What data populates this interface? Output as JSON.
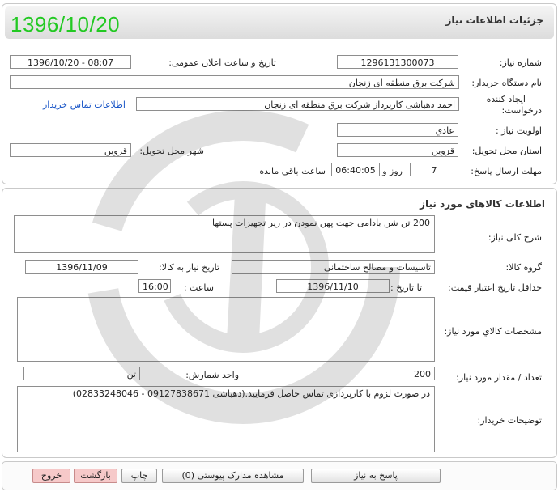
{
  "header": {
    "title": "جزئیات اطلاعات نیاز",
    "big_date": "1396/10/20"
  },
  "need_info": {
    "need_number_label": "شماره نیاز:",
    "need_number": "1296131300073",
    "announce_label": "تاریخ و ساعت اعلان عمومی:",
    "announce_value": "1396/10/20 - 08:07",
    "buyer_org_label": "نام دستگاه خریدار:",
    "buyer_org": "شرکت برق منطقه ای زنجان",
    "creator_label_1": "ایجاد کننده",
    "creator_label_2": "درخواست:",
    "creator_value": "احمد دهباشی کارپرداز شرکت برق منطقه ای زنجان",
    "contact_link": "اطلاعات تماس خریدار",
    "priority_label": "اولویت نیاز :",
    "priority_value": "عادي",
    "province_label": "استان محل تحویل:",
    "province_value": "قزوین",
    "city_label": "شهر محل تحویل:",
    "city_value": "قزوین",
    "deadline_label": "مهلت ارسال پاسخ:",
    "days_value": "7",
    "days_label": "روز و",
    "time_value": "06:40:05",
    "remaining_label": "ساعت باقی مانده"
  },
  "goods": {
    "section_title": "اطلاعات کالاهای مورد نیاز",
    "description_label": "شرح کلی نیاز:",
    "description_value": "200 تن شن بادامی جهت پهن نمودن در زیر تجهیزات پستها",
    "group_label": "گروه کالا:",
    "group_value": "تاسیسات و مصالح ساختمانی",
    "need_date_label": "تاریخ نیاز به کالا:",
    "need_date_value": "1396/11/09",
    "min_validity_label": "حداقل تاریخ اعتبار قیمت:",
    "to_date_label": "تا تاریخ :",
    "to_date_value": "1396/11/10",
    "hour_label": "ساعت :",
    "hour_value": "16:00",
    "specs_label": "مشخصات کالاي مورد نیاز:",
    "specs_value": "",
    "qty_label": "تعداد / مقدار مورد نیاز:",
    "qty_value": "200",
    "unit_label": "واحد شمارش:",
    "unit_value": "تن",
    "buyer_notes_label": "توضیحات خریدار:",
    "buyer_notes_value": "در صورت لزوم با کارپردازی تماس حاصل فرمایید.(دهباشی 09127838671 - 02833248046)"
  },
  "actions": {
    "reply": "پاسخ به نیاز",
    "attachments": "مشاهده مدارک پیوستی (0)",
    "print": "چاپ",
    "back": "بازگشت",
    "exit": "خروج"
  },
  "colors": {
    "big_date": "#22c922",
    "link": "#1a56c7",
    "exit_button": "#f6c9c9"
  }
}
